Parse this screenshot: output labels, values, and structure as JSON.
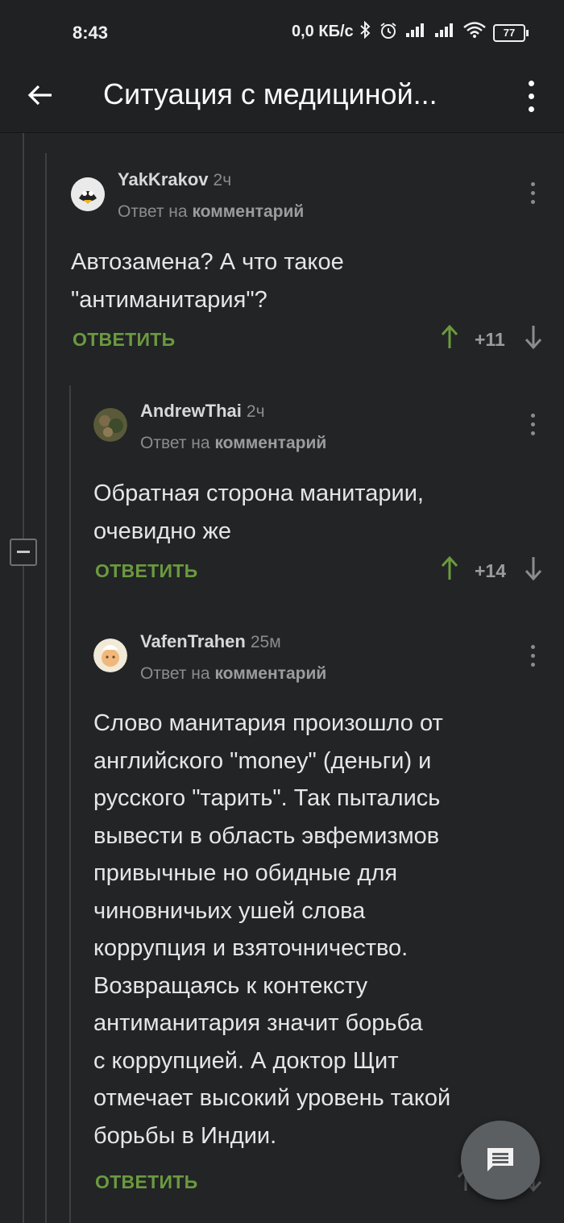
{
  "status_bar": {
    "time": "8:43",
    "network_speed": "0,0 КБ/с",
    "battery": "77"
  },
  "app_bar": {
    "title": "Ситуация с медициной..."
  },
  "comments": [
    {
      "author": "YakKrakov",
      "age": "2ч",
      "reply_prefix": "Ответ на",
      "reply_target": "комментарий",
      "text_lines": [
        "Автозамена? А что такое",
        "\"антиманитария\"?"
      ],
      "reply_label": "ОТВЕТИТЬ",
      "score": "+11"
    },
    {
      "author": "AndrewThai",
      "age": "2ч",
      "reply_prefix": "Ответ на",
      "reply_target": "комментарий",
      "text_lines": [
        "Обратная сторона манитарии,",
        "очевидно же"
      ],
      "reply_label": "ОТВЕТИТЬ",
      "score": "+14"
    },
    {
      "author": "VafenTrahen",
      "age": "25м",
      "reply_prefix": "Ответ на",
      "reply_target": "комментарий",
      "text_lines": [
        "Слово манитария произошло от",
        "английского \"money\" (деньги) и",
        "русского \"тарить\". Так пытались",
        "вывести в область эвфемизмов",
        "привычные но обидные для",
        "чиновничьих ушей слова",
        "коррупция и взяточничество.",
        "Возвращаясь к контексту",
        "антиманитария значит борьба",
        "с коррупцией. А доктор Щит",
        "отмечает высокий уровень такой",
        "борьбы в Индии."
      ],
      "reply_label": "ОТВЕТИТЬ"
    }
  ],
  "icons": {
    "back": "arrow-left-icon",
    "menu": "more-vertical-icon",
    "upvote": "arrow-up-icon",
    "downvote": "arrow-down-icon",
    "fab": "comment-icon",
    "collapse": "minus-square-icon"
  },
  "colors": {
    "accent_green": "#6b9a3e",
    "background": "#222426"
  }
}
